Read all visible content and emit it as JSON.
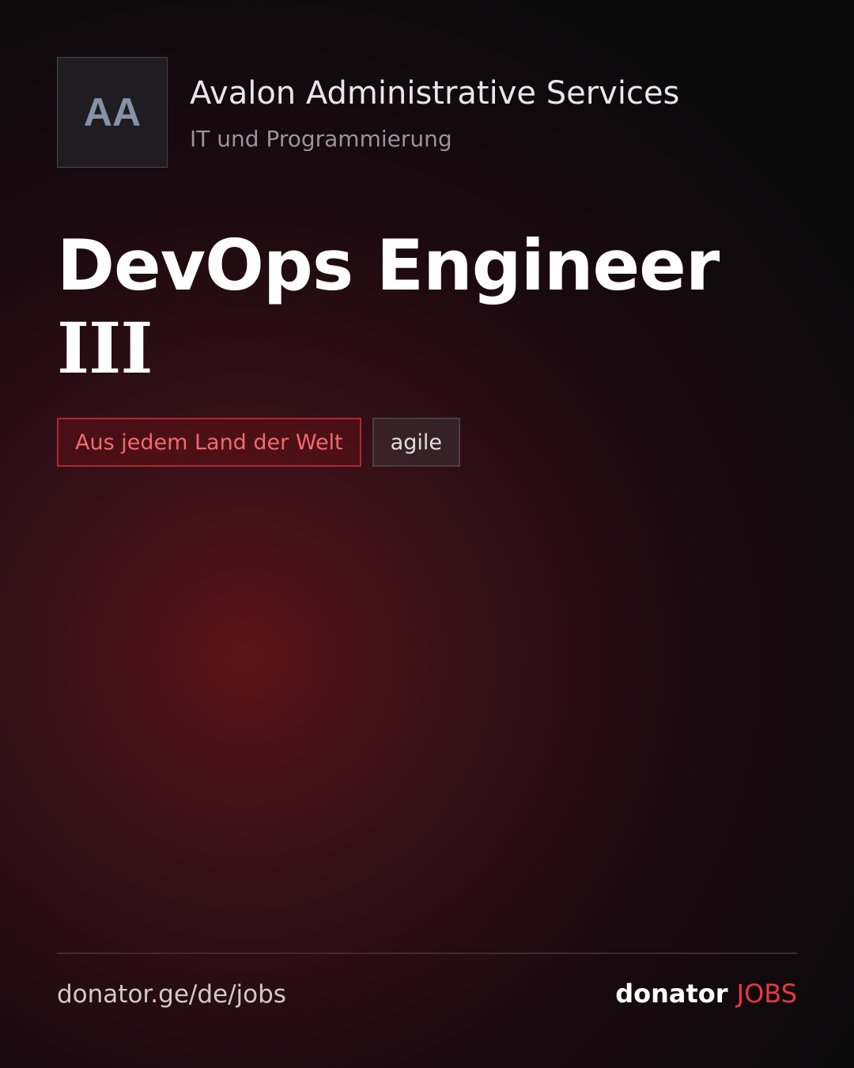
{
  "header": {
    "logo_initials": "AA",
    "company_name": "Avalon Administrative Services",
    "category": "IT und Programmierung"
  },
  "job": {
    "title_line1": "DevOps Engineer",
    "title_line2": "III"
  },
  "tags": {
    "location": "Aus jedem Land der Welt",
    "skill": "agile"
  },
  "footer": {
    "url": "donator.ge/de/jobs",
    "brand_main": "donator",
    "brand_accent": "JOBS"
  },
  "colors": {
    "accent": "#e8383f",
    "tag_location_border": "#b1272f",
    "background": "#0b0a0b",
    "glow": "#5a1418"
  }
}
